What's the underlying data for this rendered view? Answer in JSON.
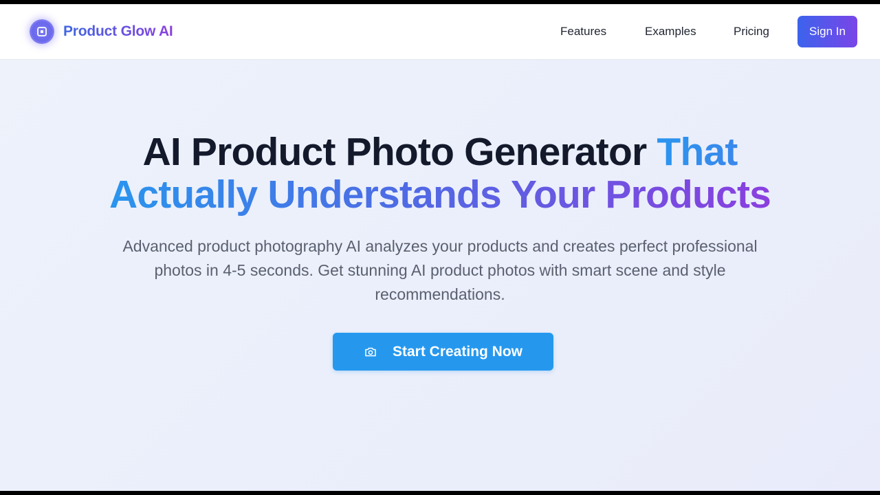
{
  "brand": {
    "name": "Product Glow AI",
    "logo_icon": "square-focus-icon"
  },
  "nav": {
    "links": [
      "Features",
      "Examples",
      "Pricing"
    ],
    "signin_label": "Sign In"
  },
  "hero": {
    "headline_dark": "AI Product Photo Generator",
    "headline_that": "That",
    "headline_gradient": "Actually Understands Your Products",
    "subtitle": "Advanced product photography AI analyzes your products and creates perfect professional photos in 4-5 seconds. Get stunning AI product photos with smart scene and style recommendations.",
    "cta_label": "Start Creating Now",
    "cta_icon": "camera-icon"
  },
  "colors": {
    "accent_blue": "#2598ee",
    "brand_purple": "#7a45e8",
    "headline_dark": "#141a2b",
    "body_text": "#5a6070"
  }
}
